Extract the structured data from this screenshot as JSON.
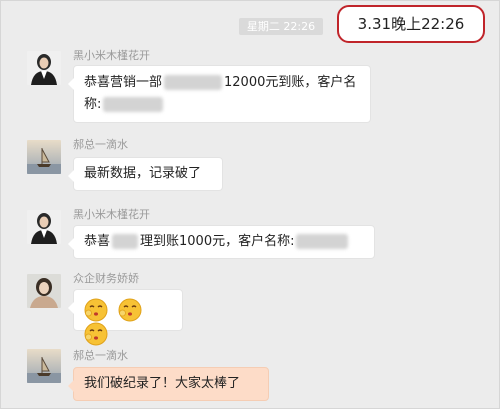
{
  "header": {
    "day_time": "星期二 22:26",
    "callout": "3.31晚上22:26"
  },
  "messages": [
    {
      "sender": "黑小米木槿花开",
      "text_a": "恭喜营销一部",
      "text_b": "12000元到账，客户名",
      "text_c": "称:"
    },
    {
      "sender": "郝总一滴水",
      "text": "最新数据，记录破了"
    },
    {
      "sender": "黑小米木槿花开",
      "text_a": "恭喜",
      "text_b": "理到账1000元，客户名称:"
    },
    {
      "sender": "众企财务娇娇",
      "emojis": [
        "kiss-emoji",
        "kiss-emoji",
        "kiss-emoji"
      ]
    },
    {
      "sender": "郝总一滴水",
      "text": "我们破纪录了！大家太棒了"
    }
  ],
  "colors": {
    "background": "#ececec",
    "bubble": "#ffffff",
    "highlight_bubble": "#fddcc8",
    "callout_border": "#c0242a"
  }
}
